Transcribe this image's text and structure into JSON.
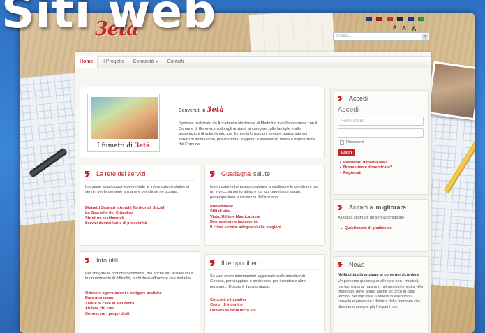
{
  "slide": {
    "title": "Siti web"
  },
  "site": {
    "logo": "3età",
    "search_placeholder": "Cerca...",
    "font_sizes": [
      "A",
      "A",
      "A"
    ],
    "flag_colors": [
      "#1e3d8c",
      "#b11b1b",
      "#cc3333",
      "#2b2b2b",
      "#0f3d8f",
      "#2e9944"
    ]
  },
  "nav": {
    "items": [
      "Home",
      "Il Progetto",
      "Comunità",
      "Contatti"
    ],
    "active": "Home"
  },
  "welcome": {
    "comic_caption_pre": "I fumetti di",
    "comic_caption_logo": "3età",
    "heading_pre": "Benvenuti in",
    "heading_logo": "3età",
    "text": "Il portale realizzato da Accademia Nazionale di Medicina in collaborazione con il Comune di Genova, rivolto agli anziani, ai caregiver, alle famiglie e alle associazioni di volontariato, per fornire informazioni sempre aggiornate sui servizi di animazione, prevenzione, supporto e assistenza messi a disposizione dal Comune."
  },
  "boxes": {
    "rete": {
      "title_accent": "La rete dei servizi",
      "title_rest": "",
      "text": "In questo spazio puoi reperire tutte le informazioni relative ai servizi per le persone anziane e per chi se ne occupa.",
      "links": [
        "Distretti Sanitari e Ambiti Territoriali Sociali",
        "Lo Sportello del Cittadino",
        "Strutture residenziali",
        "Servizi domiciliari e di prossimità"
      ]
    },
    "guadagna": {
      "title_accent": "Guadagna",
      "title_rest": "salute",
      "text": "Informazioni che possono aiutare a migliorare le condizioni per un invecchiamento attivo e sui tuoi buoni suoi salute, partecipazione e sicurezza dell'anziano.",
      "links": [
        "Prevenzione",
        "Stili di vita",
        "Vista, Udito e Masticazione",
        "Depressione e isolamento",
        "Il clima e come adeguarsi alle stagioni"
      ]
    },
    "info": {
      "title_accent": "",
      "title_rest": "Info utili",
      "text": "Per sbrigare le pratiche quotidiane, ma anche per aiutare chi è in un momento di difficoltà, o chi deve affrontare una malattia.",
      "links": [
        "Ottenere agevolazioni e sbrigare pratiche",
        "Dare una mano",
        "Vivere la casa in sicurezza",
        "Aiutare chi cura",
        "Conoscere i propri diritti"
      ]
    },
    "tempo": {
      "title_accent": "",
      "title_rest": "Il tempo libero",
      "text": "Se vuoi avere informazioni aggiornate sulle iniziative di Genova, per viaggiare o anche solo per incontrare altre persone... Questo è il posto giusto.",
      "links": [
        "Concerti e iniziative",
        "Centri di incontro",
        "Università della terza età"
      ]
    }
  },
  "sidebar": {
    "accedi": {
      "title": "Accedi",
      "subtitle": "Accedi",
      "username_placeholder": "Nome utente",
      "password_placeholder": "",
      "remember": "Ricordami",
      "login_button": "Login",
      "links": [
        "Password dimenticata?",
        "Nome utente dimenticato?",
        "Registrati"
      ]
    },
    "aiutaci": {
      "title_pre": "Aiutaci a",
      "title_bold": "migliorare",
      "text": "Aiutaci a costruire un servizio migliore!",
      "link": "Questionario di gradimento"
    },
    "news": {
      "title": "News",
      "headline": "Nella città più anziana si corre per ricordare",
      "body": "Un percorso gioioso per allenare non i muscoli, ma la memoria: nascono nei prossimi mesi a villa Imperiale, dove aprirà anche un circo in città terzioni per imparare a tenere in esercizio il cervello e prevenire i disturbi della memoria che diventano sempre più frequenti con"
    }
  }
}
